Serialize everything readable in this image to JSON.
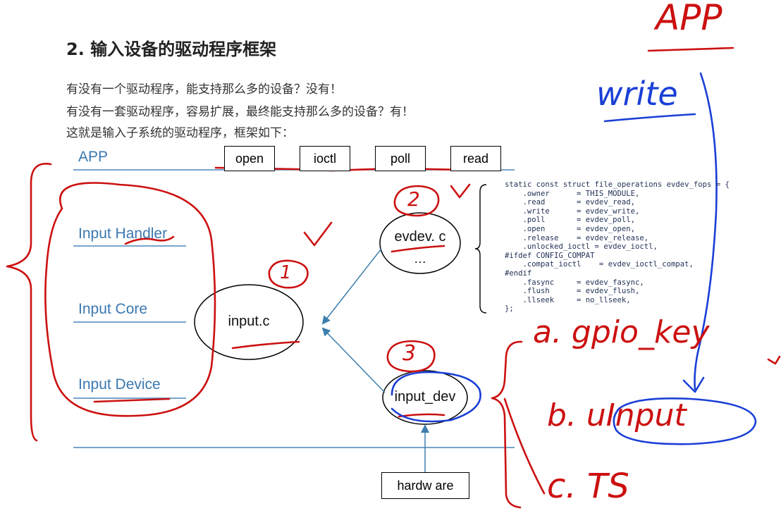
{
  "title": "2. 输入设备的驱动程序框架",
  "intro": [
    "有没有一个驱动程序，能支持那么多的设备？没有！",
    "有没有一套驱动程序，容易扩展，最终能支持那么多的设备？有！",
    "这就是输入子系统的驱动程序，框架如下："
  ],
  "layers": {
    "app": "APP",
    "handler": "Input  Handler",
    "core": "Input  Core",
    "device": "Input  Device"
  },
  "app_calls": [
    "open",
    "ioctl",
    "poll",
    "read"
  ],
  "nodes": {
    "input_c": "input.c",
    "evdev_c": "evdev. c",
    "evdev_more": "…",
    "input_dev": "input_dev",
    "hardware": "hardw are"
  },
  "code_lines": [
    "static const struct file_operations evdev_fops = {",
    "    .owner      = THIS_MODULE,",
    "    .read       = evdev_read,",
    "    .write      = evdev_write,",
    "    .poll       = evdev_poll,",
    "    .open       = evdev_open,",
    "    .release    = evdev_release,",
    "    .unlocked_ioctl = evdev_ioctl,",
    "#ifdef CONFIG_COMPAT",
    "    .compat_ioctl    = evdev_ioctl_compat,",
    "#endif",
    "    .fasync     = evdev_fasync,",
    "    .flush      = evdev_flush,",
    "    .llseek     = no_llseek,",
    "};"
  ],
  "handwritten": {
    "app": "APP",
    "write": "write",
    "num1": "1",
    "num2": "2",
    "num3": "3",
    "list_a": "a. gpio_key",
    "list_b": "b. uInput",
    "list_c": "c. TS"
  },
  "colors": {
    "layer_text": "#3b78b0",
    "layer_line": "#4a85b8",
    "arrow": "#3d7fae",
    "ink_red": "#cc1010",
    "ink_blue": "#1a3fd6"
  }
}
